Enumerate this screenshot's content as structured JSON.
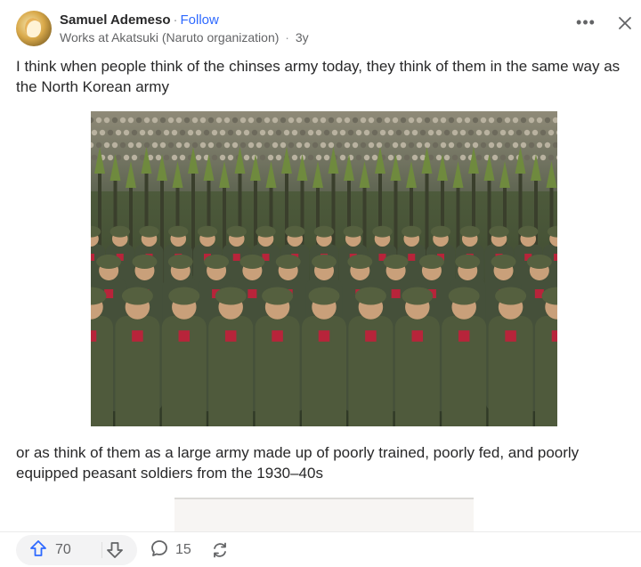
{
  "header": {
    "author": "Samuel Ademeso",
    "separator": "·",
    "follow_label": "Follow",
    "credential": "Works at Akatsuki (Naruto organization)",
    "time_separator": "·",
    "time_ago": "3y",
    "more_icon": "more-horizontal-icon",
    "more_glyph": "•••",
    "close_icon": "close-icon"
  },
  "post": {
    "paragraph1": "I think when people think of the chinses army today, they think of them in the same way as the North Korean army",
    "paragraph2": "or as think of them as a large army made up of poorly trained, poorly fed, and poorly equipped peasant soldiers from the 1930–40s"
  },
  "actions": {
    "upvote_icon": "upvote-arrow-icon",
    "upvote_count": "70",
    "downvote_icon": "downvote-arrow-icon",
    "comment_icon": "comment-icon",
    "comment_count": "15",
    "share_icon": "reshare-icon"
  },
  "colors": {
    "link": "#2e69ff",
    "text": "#282829",
    "secondary": "#636466"
  }
}
